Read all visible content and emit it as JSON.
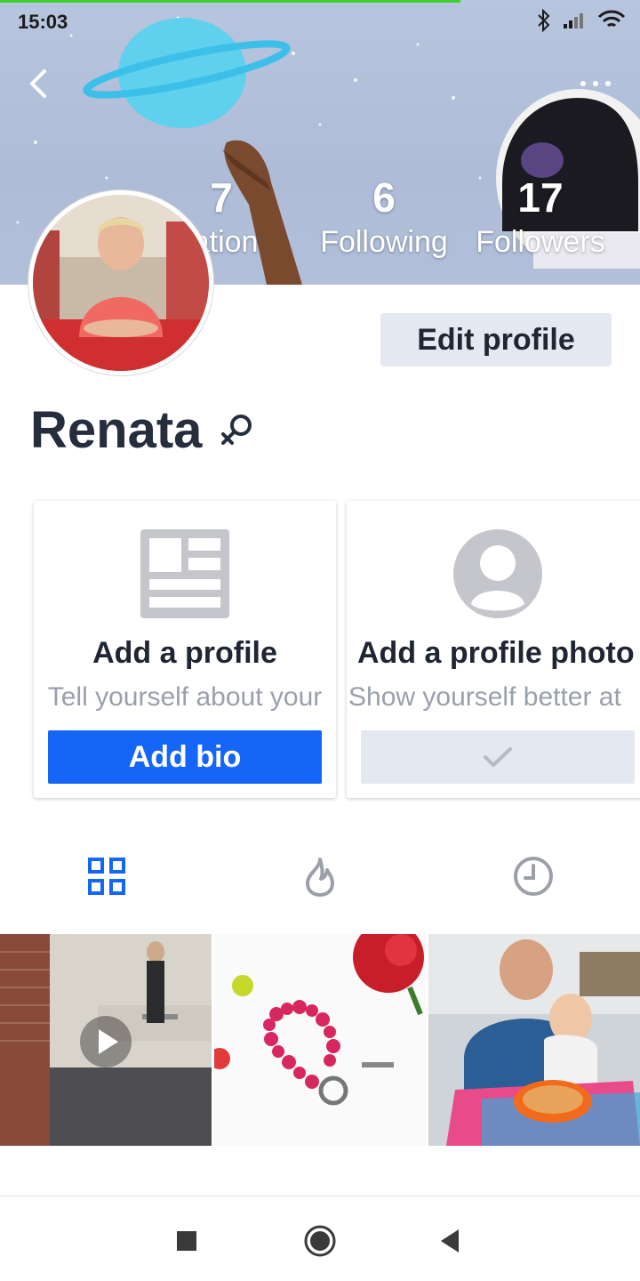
{
  "status_bar": {
    "time": "15:03",
    "icons": [
      "bluetooth-icon",
      "signal-icon",
      "wifi-icon"
    ]
  },
  "header": {
    "back_icon": "chevron-left-icon",
    "more_icon": "more-horizontal-icon"
  },
  "stats": [
    {
      "value": "7",
      "label": "Reputation"
    },
    {
      "value": "6",
      "label": "Following"
    },
    {
      "value": "17",
      "label": "Followers"
    }
  ],
  "profile": {
    "name": "Renata",
    "gender_icon": "female-symbol-icon",
    "edit_label": "Edit profile"
  },
  "cards": [
    {
      "icon": "article-layout-icon",
      "title": "Add a profile",
      "desc": "Tell yourself about your",
      "button": "Add bio"
    },
    {
      "icon": "user-avatar-icon",
      "title": "Add a profile photo",
      "desc": "Show yourself better at",
      "button_icon": "check-icon"
    }
  ],
  "tabs": [
    {
      "name": "grid",
      "icon": "grid-icon",
      "active": true
    },
    {
      "name": "hot",
      "icon": "flame-icon",
      "active": false
    },
    {
      "name": "recent",
      "icon": "clock-icon",
      "active": false
    }
  ],
  "posts": [
    {
      "type": "video",
      "subject": "band-rehearsal"
    },
    {
      "type": "photo",
      "subject": "pink-bead-bracelet"
    },
    {
      "type": "photo",
      "subject": "spaghetti-dinner"
    }
  ],
  "colors": {
    "accent": "#1565f6",
    "status_progress": "#3fcf2f",
    "text": "#1f2533",
    "muted": "#9aa0ab",
    "button_grey": "#e4e8f0"
  },
  "nav_bar": [
    "recents-square",
    "home-circle",
    "back-triangle"
  ]
}
